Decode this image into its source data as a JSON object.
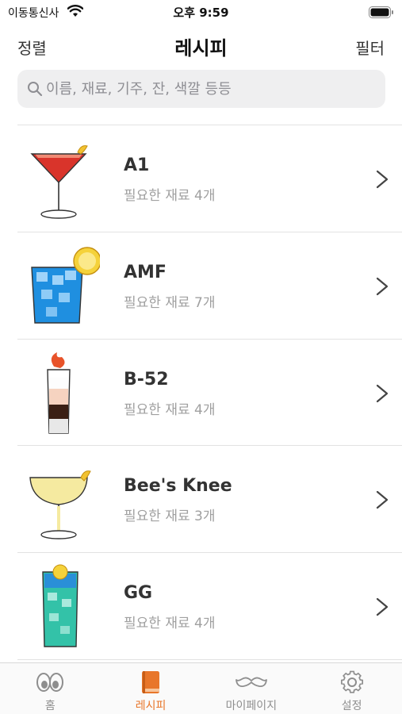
{
  "status": {
    "carrier": "이동통신사",
    "time": "오후 9:59"
  },
  "nav": {
    "left": "정렬",
    "title": "레시피",
    "right": "필터"
  },
  "search": {
    "placeholder": "이름, 재료, 기주, 잔, 색깔 등등"
  },
  "recipes": [
    {
      "name": "A1",
      "sub": "필요한 재료 4개",
      "glass": "martini-glass-icon"
    },
    {
      "name": "AMF",
      "sub": "필요한 재료 7개",
      "glass": "highball-glass-icon"
    },
    {
      "name": "B-52",
      "sub": "필요한 재료 4개",
      "glass": "shot-glass-icon"
    },
    {
      "name": "Bee's Knee",
      "sub": "필요한 재료 3개",
      "glass": "coupe-glass-icon"
    },
    {
      "name": "GG",
      "sub": "필요한 재료 4개",
      "glass": "collins-glass-icon"
    }
  ],
  "tabs": [
    {
      "label": "홈",
      "icon": "eyes-icon"
    },
    {
      "label": "레시피",
      "icon": "book-icon",
      "active": true
    },
    {
      "label": "마이페이지",
      "icon": "mustache-icon"
    },
    {
      "label": "설정",
      "icon": "gear-icon"
    }
  ],
  "colors": {
    "accent": "#e8762a",
    "chevron": "#444444",
    "secondary_text": "#a0a0a0"
  }
}
